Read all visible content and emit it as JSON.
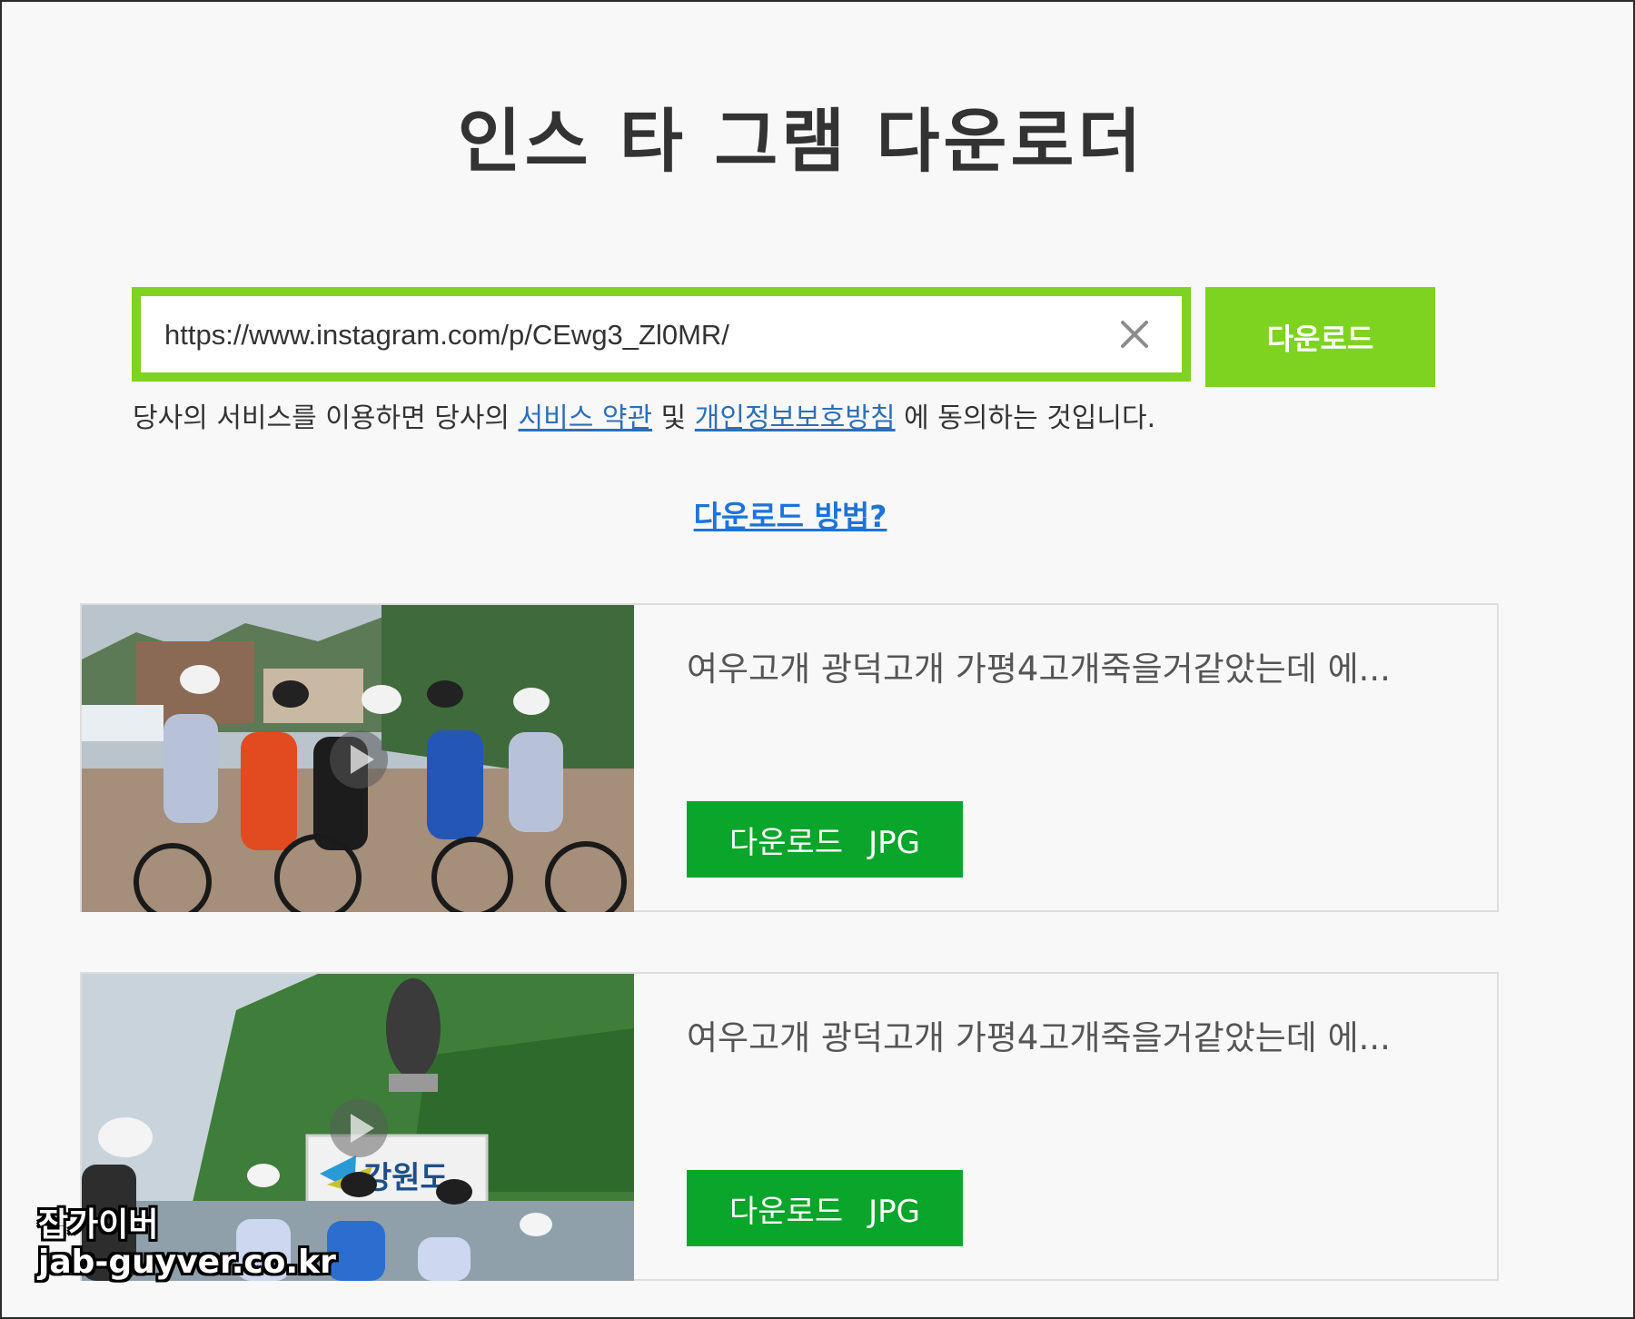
{
  "page": {
    "title": "인스 타 그램 다운로더"
  },
  "search": {
    "url_value": "https://www.instagram.com/p/CEwg3_Zl0MR/",
    "clear_icon": "close-icon",
    "download_label": "다운로드"
  },
  "terms": {
    "prefix": "당사의 서비스를 이용하면 당사의 ",
    "terms_link": "서비스 약관",
    "and": " 및 ",
    "privacy_link": "개인정보보호방침",
    "suffix": " 에 동의하는 것입니다."
  },
  "howto": {
    "label": "다운로드 방법?"
  },
  "results": [
    {
      "caption": "여우고개 광덕고개 가평4고개죽을거같았는데 에...",
      "download_label": "다운로드",
      "format": "JPG"
    },
    {
      "caption": "여우고개 광덕고개 가평4고개죽을거같았는데 에...",
      "download_label": "다운로드",
      "format": "JPG"
    }
  ],
  "watermark": {
    "line1": "잡가이버",
    "line2": "jab-guyver.co.kr"
  },
  "colors": {
    "accent_green": "#7ed321",
    "button_green": "#0aa52b",
    "link_blue": "#2d6fb8"
  }
}
